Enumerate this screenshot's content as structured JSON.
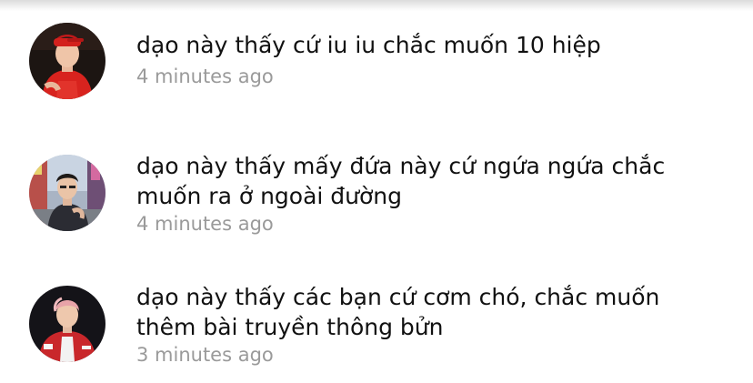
{
  "comments": [
    {
      "text": "dạo này thấy cứ iu iu chắc muốn 10 hiệp",
      "time": "4 minutes ago",
      "avatar_icon": "user-avatar-red-shirt"
    },
    {
      "text": "dạo này thấy mấy đứa này cứ ngứa ngứa chắc muốn ra ở ngoài đường",
      "time": "4 minutes ago",
      "avatar_icon": "user-avatar-street"
    },
    {
      "text": "dạo này thấy các bạn cứ cơm chó, chắc muốn thêm bài truyền thông bửn",
      "time": "3 minutes ago",
      "avatar_icon": "user-avatar-red-jacket"
    }
  ]
}
